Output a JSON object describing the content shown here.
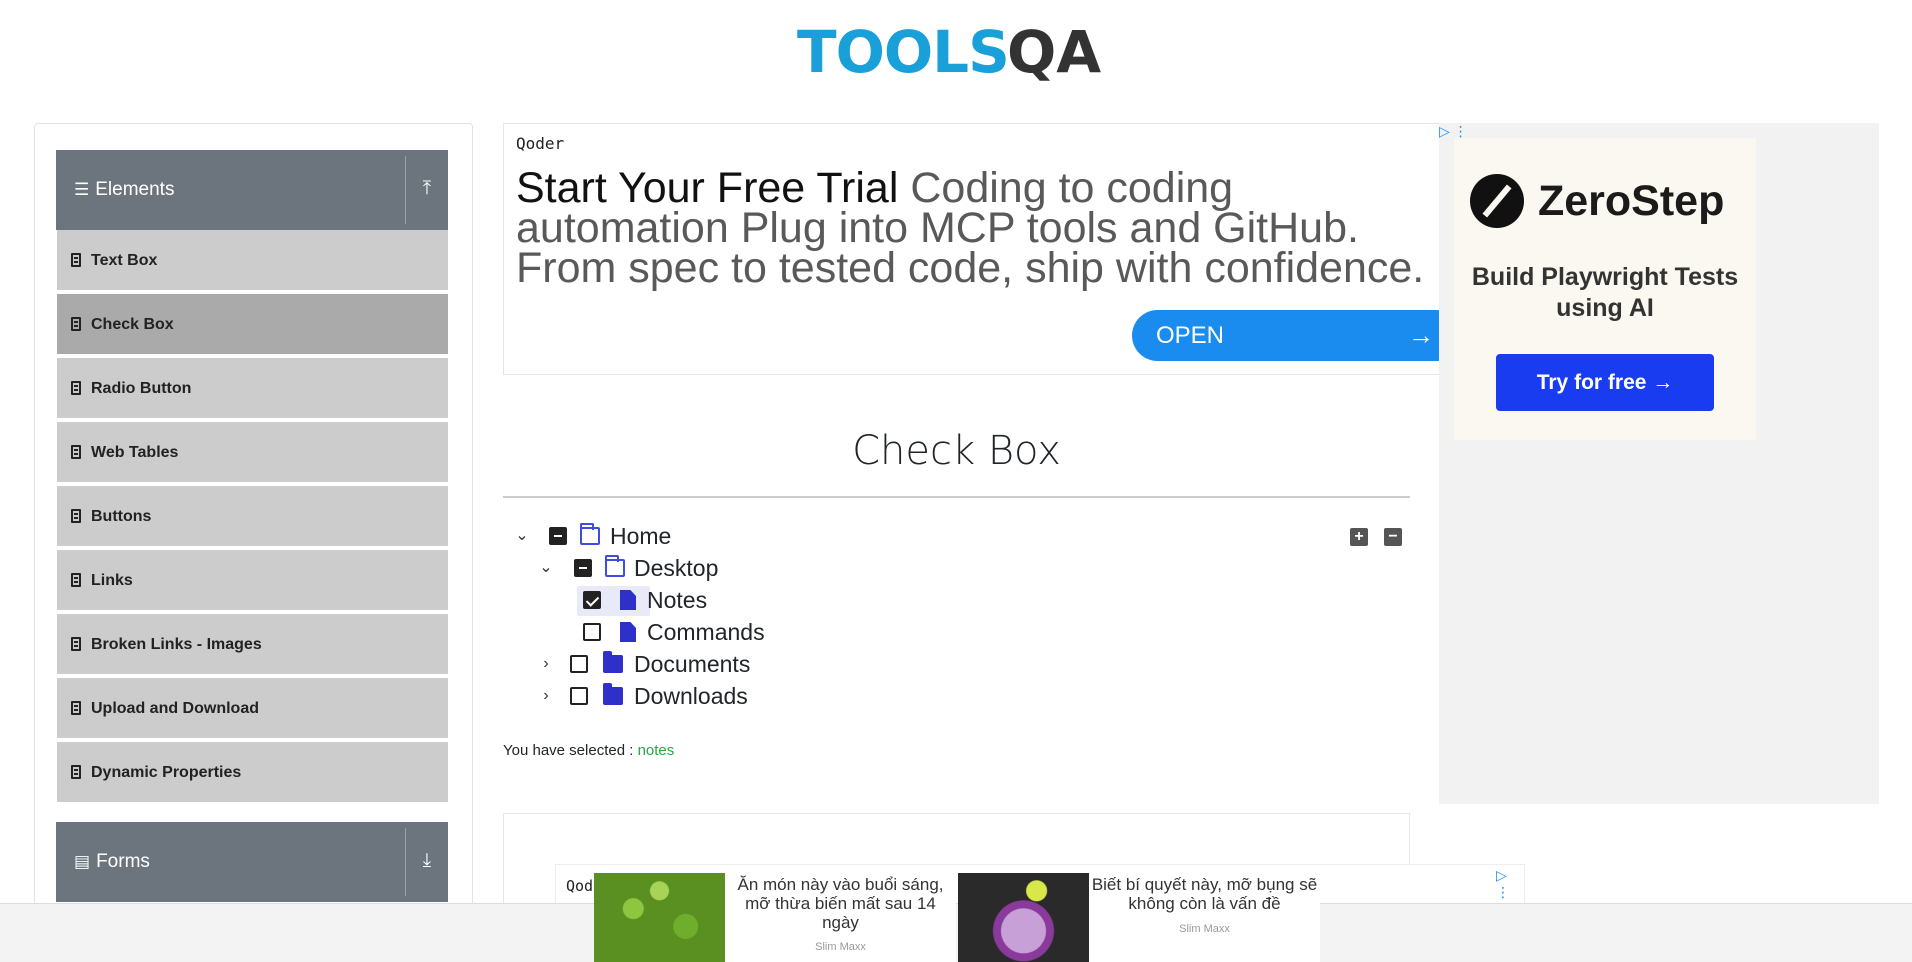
{
  "header": {
    "logo_text_left": "TOOLS",
    "logo_text_right": "QA"
  },
  "sidebar": {
    "elements_group": {
      "label": "Elements",
      "icon": "hamburger-icon",
      "toggle_icon": "upload-icon"
    },
    "items": [
      {
        "label": "Text Box",
        "active": false
      },
      {
        "label": "Check Box",
        "active": true
      },
      {
        "label": "Radio Button",
        "active": false
      },
      {
        "label": "Web Tables",
        "active": false
      },
      {
        "label": "Buttons",
        "active": false
      },
      {
        "label": "Links",
        "active": false
      },
      {
        "label": "Broken Links - Images",
        "active": false
      },
      {
        "label": "Upload and Download",
        "active": false
      },
      {
        "label": "Dynamic Properties",
        "active": false
      }
    ],
    "forms_group": {
      "label": "Forms",
      "icon": "document-icon",
      "toggle_icon": "download-icon"
    }
  },
  "ad_top": {
    "brand": "Qoder",
    "headline_strong": "Start Your Free Trial",
    "headline_rest": "Coding to coding automation Plug into MCP tools and GitHub. From spec to tested code, ship with confidence.",
    "button": "OPEN",
    "button_arrow": "→"
  },
  "ad_right": {
    "adchoice": "▷ ⋮",
    "brand": "ZeroStep",
    "subtitle": "Build Playwright Tests using AI",
    "button": "Try for free →"
  },
  "main": {
    "title": "Check Box",
    "tree": {
      "home": "Home",
      "desktop": "Desktop",
      "notes": "Notes",
      "commands": "Commands",
      "documents": "Documents",
      "downloads": "Downloads",
      "expand_all": "+",
      "collapse_all": "−"
    },
    "selected_label": "You have selected :",
    "selected_value": "notes"
  },
  "ad_bottom": {
    "brand": "Qoder",
    "adchoice": "▷ ⋮",
    "collapse_caret": "⌄",
    "cards": [
      {
        "title": "Ăn món này vào buổi sáng, mỡ thừa biến mất sau 14 ngày",
        "sponsor": "Slim Maxx"
      },
      {
        "title": "Biết bí quyết này, mỡ bụng sẽ không còn là vấn đề",
        "sponsor": "Slim Maxx"
      }
    ]
  },
  "colors": {
    "accent_blue": "#1a8cf0",
    "sidebar_header": "#6c757d",
    "menu_item": "#cccccc",
    "menu_item_active": "#aaaaaa",
    "selected_value": "#28a745",
    "folder_icon": "#2f2fc9",
    "zerostep_button": "#1a3cf0"
  }
}
